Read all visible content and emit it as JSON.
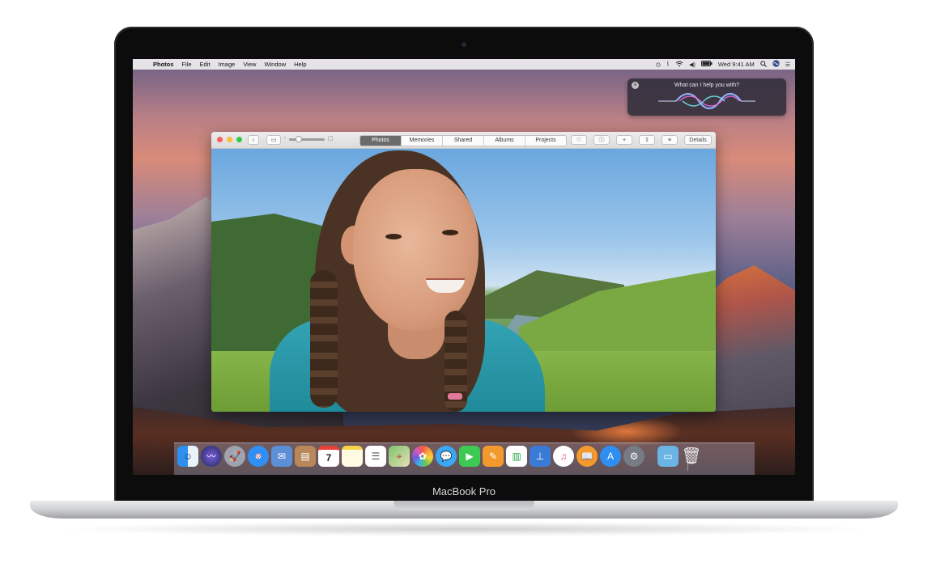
{
  "menubar": {
    "app_name": "Photos",
    "menus": [
      "File",
      "Edit",
      "Image",
      "View",
      "Window",
      "Help"
    ],
    "clock": "Wed 9:41 AM"
  },
  "siri": {
    "prompt": "What can I help you with?"
  },
  "photos_window": {
    "tabs": [
      "Photos",
      "Memories",
      "Shared",
      "Albums",
      "Projects"
    ],
    "active_tab": "Photos",
    "details_label": "Details"
  },
  "dock": {
    "apps": [
      "Finder",
      "Siri",
      "Launchpad",
      "Safari",
      "Mail",
      "Contacts",
      "Calendar",
      "Notes",
      "Reminders",
      "Maps",
      "Photos",
      "Messages",
      "FaceTime",
      "Pages",
      "Numbers",
      "Keynote",
      "iTunes",
      "iBooks",
      "App Store",
      "System Preferences",
      "Downloads",
      "Trash"
    ],
    "calendar_day": "7"
  },
  "device": {
    "brand_label": "MacBook Pro"
  },
  "colors": {
    "traffic_red": "#fc605c",
    "traffic_yellow": "#fdbc40",
    "traffic_green": "#34c84a",
    "active_tab_bg": "#6b6b6b"
  }
}
